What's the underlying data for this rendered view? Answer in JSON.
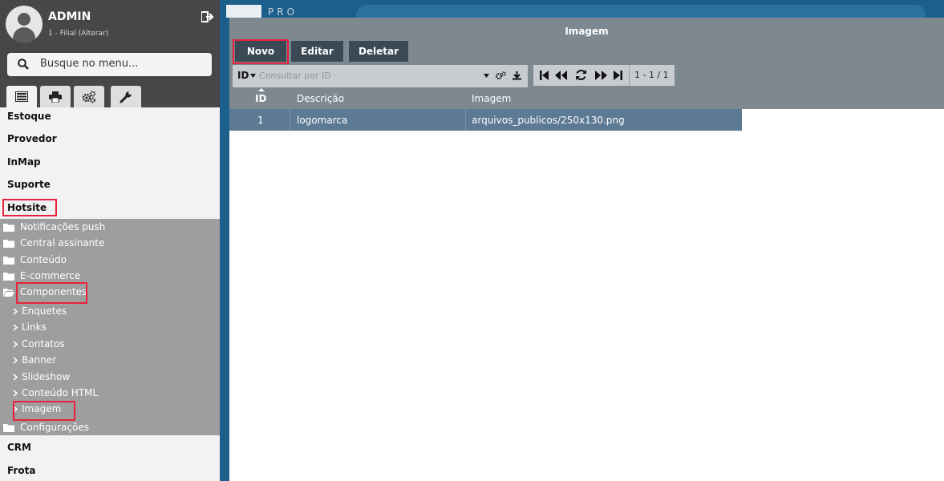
{
  "user": {
    "name": "ADMIN",
    "branch": "1 - Filial (Alterar)"
  },
  "search": {
    "placeholder": "Busque no menu..."
  },
  "tabs": [
    "list-icon",
    "printer-icon",
    "gears-icon",
    "wrench-icon"
  ],
  "menu": {
    "top": [
      "Estoque",
      "Provedor",
      "InMap",
      "Suporte",
      "Hotsite"
    ],
    "hotsite_children": [
      "Notificações push",
      "Central assinante",
      "Conteúdo",
      "E-commerce",
      "Componentes"
    ],
    "componentes_children": [
      "Enquetes",
      "Links",
      "Contatos",
      "Banner",
      "Slideshow",
      "Conteúdo HTML",
      "Imagem"
    ],
    "after_components": "Configurações",
    "bottom": [
      "CRM",
      "Frota"
    ]
  },
  "background_header": {
    "text": "PRO"
  },
  "dialog": {
    "title": "Imagem",
    "buttons": {
      "new": "Novo",
      "edit": "Editar",
      "delete": "Deletar"
    },
    "filter": {
      "field": "ID",
      "placeholder": "Consultar por ID"
    },
    "pager": {
      "count": "1 - 1 / 1"
    },
    "table": {
      "columns": [
        "ID",
        "Descrição",
        "Imagem"
      ],
      "rows": [
        {
          "id": "1",
          "descricao": "logomarca",
          "imagem": "arquivos_publicos/250x130.png"
        }
      ]
    }
  },
  "colors": {
    "accent_highlight": "#e8213c",
    "row_selected": "#5d7a94",
    "toolbar_button": "#3a4954"
  }
}
